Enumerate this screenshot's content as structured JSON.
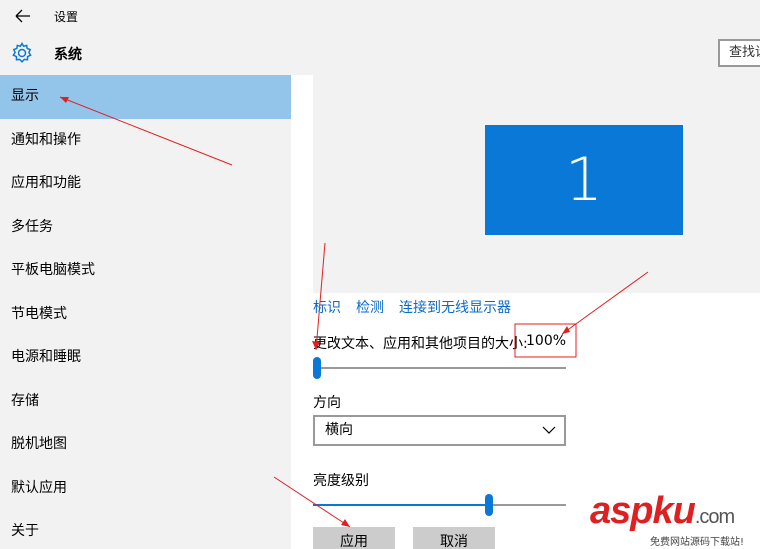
{
  "window": {
    "title": "设置"
  },
  "header": {
    "title": "系统",
    "search_value": "查找设"
  },
  "sidebar": {
    "items": [
      {
        "label": "显示",
        "active": true
      },
      {
        "label": "通知和操作"
      },
      {
        "label": "应用和功能"
      },
      {
        "label": "多任务"
      },
      {
        "label": "平板电脑模式"
      },
      {
        "label": "节电模式"
      },
      {
        "label": "电源和睡眠"
      },
      {
        "label": "存储"
      },
      {
        "label": "脱机地图"
      },
      {
        "label": "默认应用"
      },
      {
        "label": "关于"
      }
    ]
  },
  "display": {
    "monitor_number": "1",
    "links": [
      "标识",
      "检测",
      "连接到无线显示器"
    ],
    "scale_label": "更改文本、应用和其他项目的大小:",
    "scale_value": "100%",
    "scale_slider_level": 0,
    "orientation_label": "方向",
    "orientation_value": "横向",
    "brightness_label": "亮度级别",
    "brightness_level": 0.7,
    "apply_label": "应用",
    "cancel_label": "取消"
  },
  "watermark": {
    "brand": "aspku",
    "tld": ".com",
    "tagline": "免费网站源码下载站!"
  },
  "colors": {
    "accent": "#0a78d7",
    "selected": "#93c5eb",
    "link": "#0b6ac8",
    "annotation": "#e02020"
  }
}
